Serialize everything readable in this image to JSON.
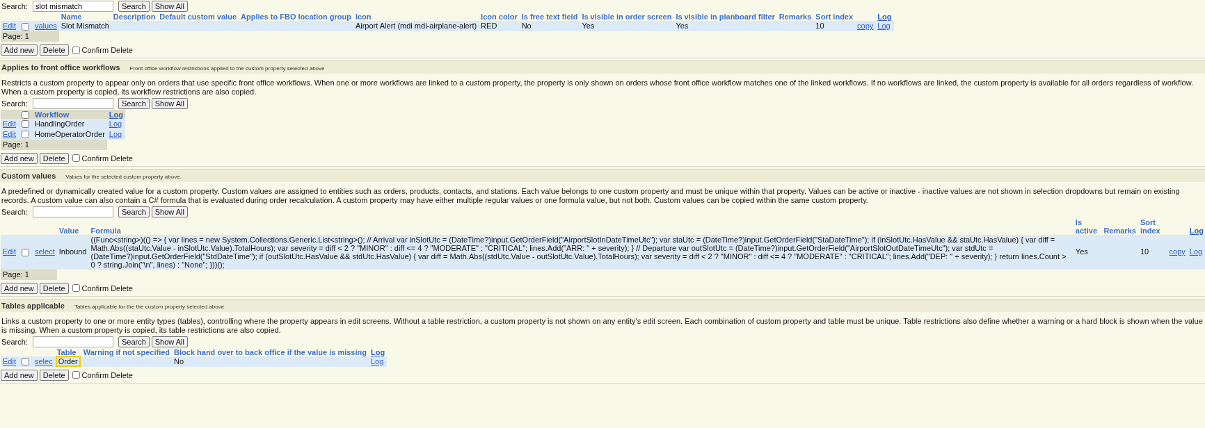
{
  "sections": [
    {
      "search": {
        "label": "Search:",
        "value": "slot mismatch"
      },
      "search_buttons": [
        "Search",
        "Show All"
      ],
      "table": {
        "columns": [
          {},
          {},
          {},
          {
            "kind": "text",
            "label": "Name"
          },
          {
            "kind": "text",
            "label": "Description"
          },
          {
            "kind": "text",
            "label": "Default custom value"
          },
          {
            "kind": "text",
            "label": "Applies to FBO location group"
          },
          {
            "kind": "text",
            "label": "Icon"
          },
          {
            "kind": "text",
            "label": "Icon color"
          },
          {
            "kind": "text",
            "label": "Is free text field"
          },
          {
            "kind": "text",
            "label": "Is visible in order screen"
          },
          {
            "kind": "text",
            "label": "Is visible in planboard filter"
          },
          {
            "kind": "text",
            "label": "Remarks"
          },
          {
            "kind": "text",
            "label": "Sort index"
          },
          {},
          {
            "kind": "link",
            "label": "Log"
          }
        ],
        "rows": [
          {
            "cells": [
              {
                "kind": "link",
                "text": "Edit"
              },
              {
                "kind": "checkbox",
                "checked": false
              },
              {
                "kind": "link",
                "text": "values"
              },
              {
                "kind": "text",
                "text": "Slot Mismatch"
              },
              {},
              {},
              {},
              {
                "kind": "text",
                "text": "Airport Alert (mdi mdi-airplane-alert)"
              },
              {
                "kind": "text",
                "text": "RED"
              },
              {
                "kind": "text",
                "text": "No"
              },
              {
                "kind": "text",
                "text": "Yes"
              },
              {
                "kind": "text",
                "text": "Yes"
              },
              {},
              {
                "kind": "text",
                "text": "10"
              },
              {
                "kind": "link",
                "text": "copy"
              },
              {
                "kind": "link",
                "text": "Log"
              }
            ]
          }
        ]
      },
      "pager": "Page: 1",
      "buttons": [
        "Add new",
        "Delete"
      ],
      "confirm": {
        "label": "Confirm Delete",
        "checked": false
      }
    },
    {
      "title": "Applies to front office workflows",
      "subtitle": "Front office workflow restrictions applied to the custom property selected above",
      "description": "Restricts a custom property to appear only on orders that use specific front office workflows. When one or more workflows are linked to a custom property, the property is only shown on orders whose front office workflow matches one of the linked workflows. If no workflows are linked, the custom property is available for all orders regardless of workflow. When a custom property is copied, its workflow restrictions are also copied.",
      "search": {
        "label": "Search:"
      },
      "search_buttons": [
        "Search",
        "Show All"
      ],
      "table": {
        "columns": [
          {},
          {
            "kind": "checkbox",
            "checked": false
          },
          {
            "kind": "text",
            "label": "Workflow"
          },
          {
            "kind": "link",
            "label": "Log"
          }
        ],
        "rows": [
          {
            "cells": [
              {
                "kind": "link",
                "text": "Edit"
              },
              {
                "kind": "checkbox",
                "checked": false
              },
              {
                "kind": "text",
                "text": "HandlingOrder"
              },
              {
                "kind": "link",
                "text": "Log"
              }
            ]
          },
          {
            "cells": [
              {
                "kind": "link",
                "text": "Edit"
              },
              {
                "kind": "checkbox",
                "checked": false
              },
              {
                "kind": "text",
                "text": "HomeOperatorOrder"
              },
              {
                "kind": "link",
                "text": "Log"
              }
            ]
          }
        ]
      },
      "pager": "Page: 1",
      "buttons": [
        "Add new",
        "Delete"
      ],
      "confirm": {
        "label": "Confirm Delete",
        "checked": false
      }
    },
    {
      "title": "Custom values",
      "subtitle": "Values for the selected custom property above.",
      "description": "A predefined or dynamically created value for a custom property. Custom values are assigned to entities such as orders, products, contacts, and stations. Each value belongs to one custom property and must be unique within that property. Values can be active or inactive - inactive values are not shown in selection dropdowns but remain on existing records. A custom value can also contain a C# formula that is evaluated during order recalculation. A custom property may have either multiple regular values or one formula value, but not both. Custom values can be copied within the same custom property.",
      "search": {
        "label": "Search:"
      },
      "search_buttons": [
        "Search",
        "Show All"
      ],
      "table": {
        "columns": [
          {},
          {},
          {},
          {
            "kind": "text",
            "label": "Value"
          },
          {
            "kind": "text",
            "label": "Formula"
          },
          {
            "kind": "text",
            "label": "Is active"
          },
          {
            "kind": "text",
            "label": "Remarks"
          },
          {
            "kind": "text",
            "label": "Sort index"
          },
          {},
          {
            "kind": "link",
            "label": "Log"
          }
        ],
        "rows": [
          {
            "cells": [
              {
                "kind": "link",
                "text": "Edit"
              },
              {
                "kind": "checkbox",
                "checked": false
              },
              {
                "kind": "link",
                "text": "select"
              },
              {
                "kind": "text",
                "text": "Inbound"
              },
              {
                "kind": "text",
                "text": "((Func<string>)(() => { var lines = new System.Collections.Generic.List<string>(); // Arrival var inSlotUtc = (DateTime?)input.GetOrderField(\"AirportSlotInDateTimeUtc\"); var staUtc = (DateTime?)input.GetOrderField(\"StaDateTime\"); if (inSlotUtc.HasValue && staUtc.HasValue) { var diff = Math.Abs((staUtc.Value - inSlotUtc.Value).TotalHours); var severity = diff < 2 ? \"MINOR\" : diff <= 4 ? \"MODERATE\" : \"CRITICAL\"; lines.Add(\"ARR: \" + severity); } // Departure var outSlotUtc = (DateTime?)input.GetOrderField(\"AirportSlotOutDateTimeUtc\"); var stdUtc = (DateTime?)input.GetOrderField(\"StdDateTime\"); if (outSlotUtc.HasValue && stdUtc.HasValue) { var diff = Math.Abs((stdUtc.Value - outSlotUtc.Value).TotalHours); var severity = diff < 2 ? \"MINOR\" : diff <= 4 ? \"MODERATE\" : \"CRITICAL\"; lines.Add(\"DEP: \" + severity); } return lines.Count > 0 ? string.Join(\"\\n\", lines) : \"None\"; }))();"
              },
              {
                "kind": "text",
                "text": "Yes"
              },
              {},
              {
                "kind": "text",
                "text": "10"
              },
              {
                "kind": "link",
                "text": "copy"
              },
              {
                "kind": "link",
                "text": "Log"
              }
            ]
          }
        ]
      },
      "pager": "Page: 1",
      "buttons": [
        "Add new",
        "Delete"
      ],
      "confirm": {
        "label": "Confirm Delete",
        "checked": false
      }
    },
    {
      "title": "Tables applicable",
      "subtitle": "Tables applicable for the the custom property selected above",
      "description": "Links a custom property to one or more entity types (tables), controlling where the property appears in edit screens. Without a table restriction, a custom property is not shown on any entity's edit screen. Each combination of custom property and table must be unique. Table restrictions also define whether a warning or a hard block is shown when the value is missing. When a custom property is copied, its table restrictions are also copied.",
      "search": {
        "label": "Search:"
      },
      "search_buttons": [
        "Search",
        "Show All"
      ],
      "table": {
        "columns": [
          {},
          {},
          {},
          {
            "kind": "text",
            "label": "Table"
          },
          {
            "kind": "text",
            "label": "Warning if not specified"
          },
          {
            "kind": "text",
            "label": "Block hand over to back office if the value is missing"
          },
          {
            "kind": "link",
            "label": "Log"
          }
        ],
        "rows": [
          {
            "cells": [
              {
                "kind": "link",
                "text": "Edit"
              },
              {
                "kind": "checkbox",
                "checked": false
              },
              {
                "kind": "link",
                "text": "selec"
              },
              {
                "kind": "text",
                "text": "Order",
                "highlighted": true
              },
              {},
              {
                "kind": "text",
                "text": "No"
              },
              {
                "kind": "link",
                "text": "Log"
              }
            ]
          }
        ]
      },
      "buttons": [
        "Add new",
        "Delete"
      ],
      "confirm": {
        "label": "Confirm Delete",
        "checked": false
      }
    }
  ]
}
